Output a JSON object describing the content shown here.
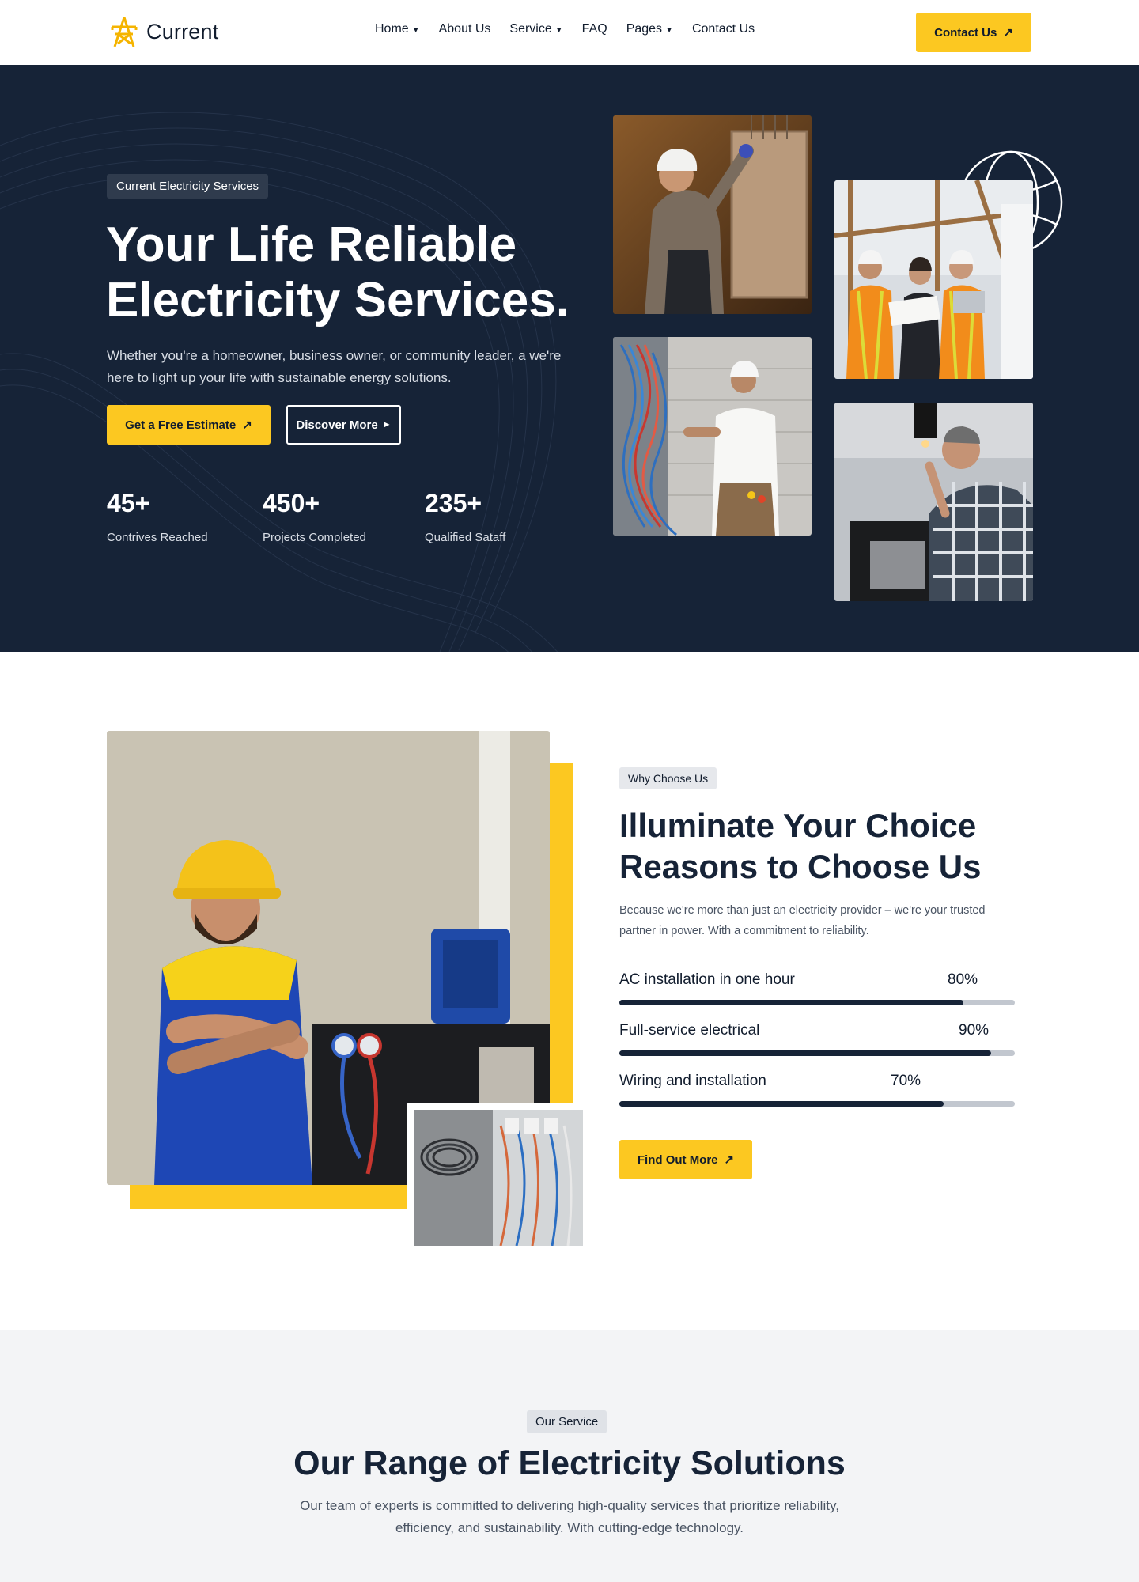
{
  "header": {
    "logo_text": "Current",
    "nav": [
      {
        "label": "Home",
        "dropdown": true
      },
      {
        "label": "About Us",
        "dropdown": false
      },
      {
        "label": "Service",
        "dropdown": true
      },
      {
        "label": "FAQ",
        "dropdown": false
      },
      {
        "label": "Pages",
        "dropdown": true
      },
      {
        "label": "Contact Us",
        "dropdown": false
      }
    ],
    "cta_label": "Contact Us"
  },
  "hero": {
    "tag": "Current Electricity Services",
    "title_line1": "Your Life Reliable",
    "title_line2": "Electricity Services.",
    "description": "Whether you're a homeowner, business owner, or community leader, a we're here to light up your life with sustainable energy solutions.",
    "primary_button": "Get a Free Estimate",
    "secondary_button": "Discover More",
    "stats": [
      {
        "value": "45+",
        "label": "Contrives Reached"
      },
      {
        "value": "450+",
        "label": "Projects Completed"
      },
      {
        "value": "235+",
        "label": "Qualified Sataff"
      }
    ]
  },
  "why": {
    "tag": "Why Choose Us",
    "title_line1": "Illuminate Your Choice",
    "title_line2": "Reasons to Choose Us",
    "description": "Because we're more than just an electricity provider – we're your trusted partner in power. With a commitment to reliability.",
    "skills": [
      {
        "label": "AC installation in one hour",
        "percent_text": "80%",
        "value": 0.87
      },
      {
        "label": "Full-service electrical",
        "percent_text": "90%",
        "value": 0.94
      },
      {
        "label": "Wiring and installation",
        "percent_text": "70%",
        "value": 0.82
      }
    ],
    "button": "Find Out More"
  },
  "services": {
    "tag": "Our Service",
    "title": "Our Range of Electricity Solutions",
    "description": "Our team of experts is committed to delivering high-quality services that prioritize reliability, efficiency, and sustainability. With cutting-edge technology."
  },
  "colors": {
    "accent": "#fcc821",
    "navy": "#162337",
    "text": "#111c2d"
  },
  "icons": {
    "logo": "transmission-tower-icon",
    "cta": "arrow-up-right-icon",
    "dropdown": "chevron-down-icon",
    "play": "play-icon"
  }
}
